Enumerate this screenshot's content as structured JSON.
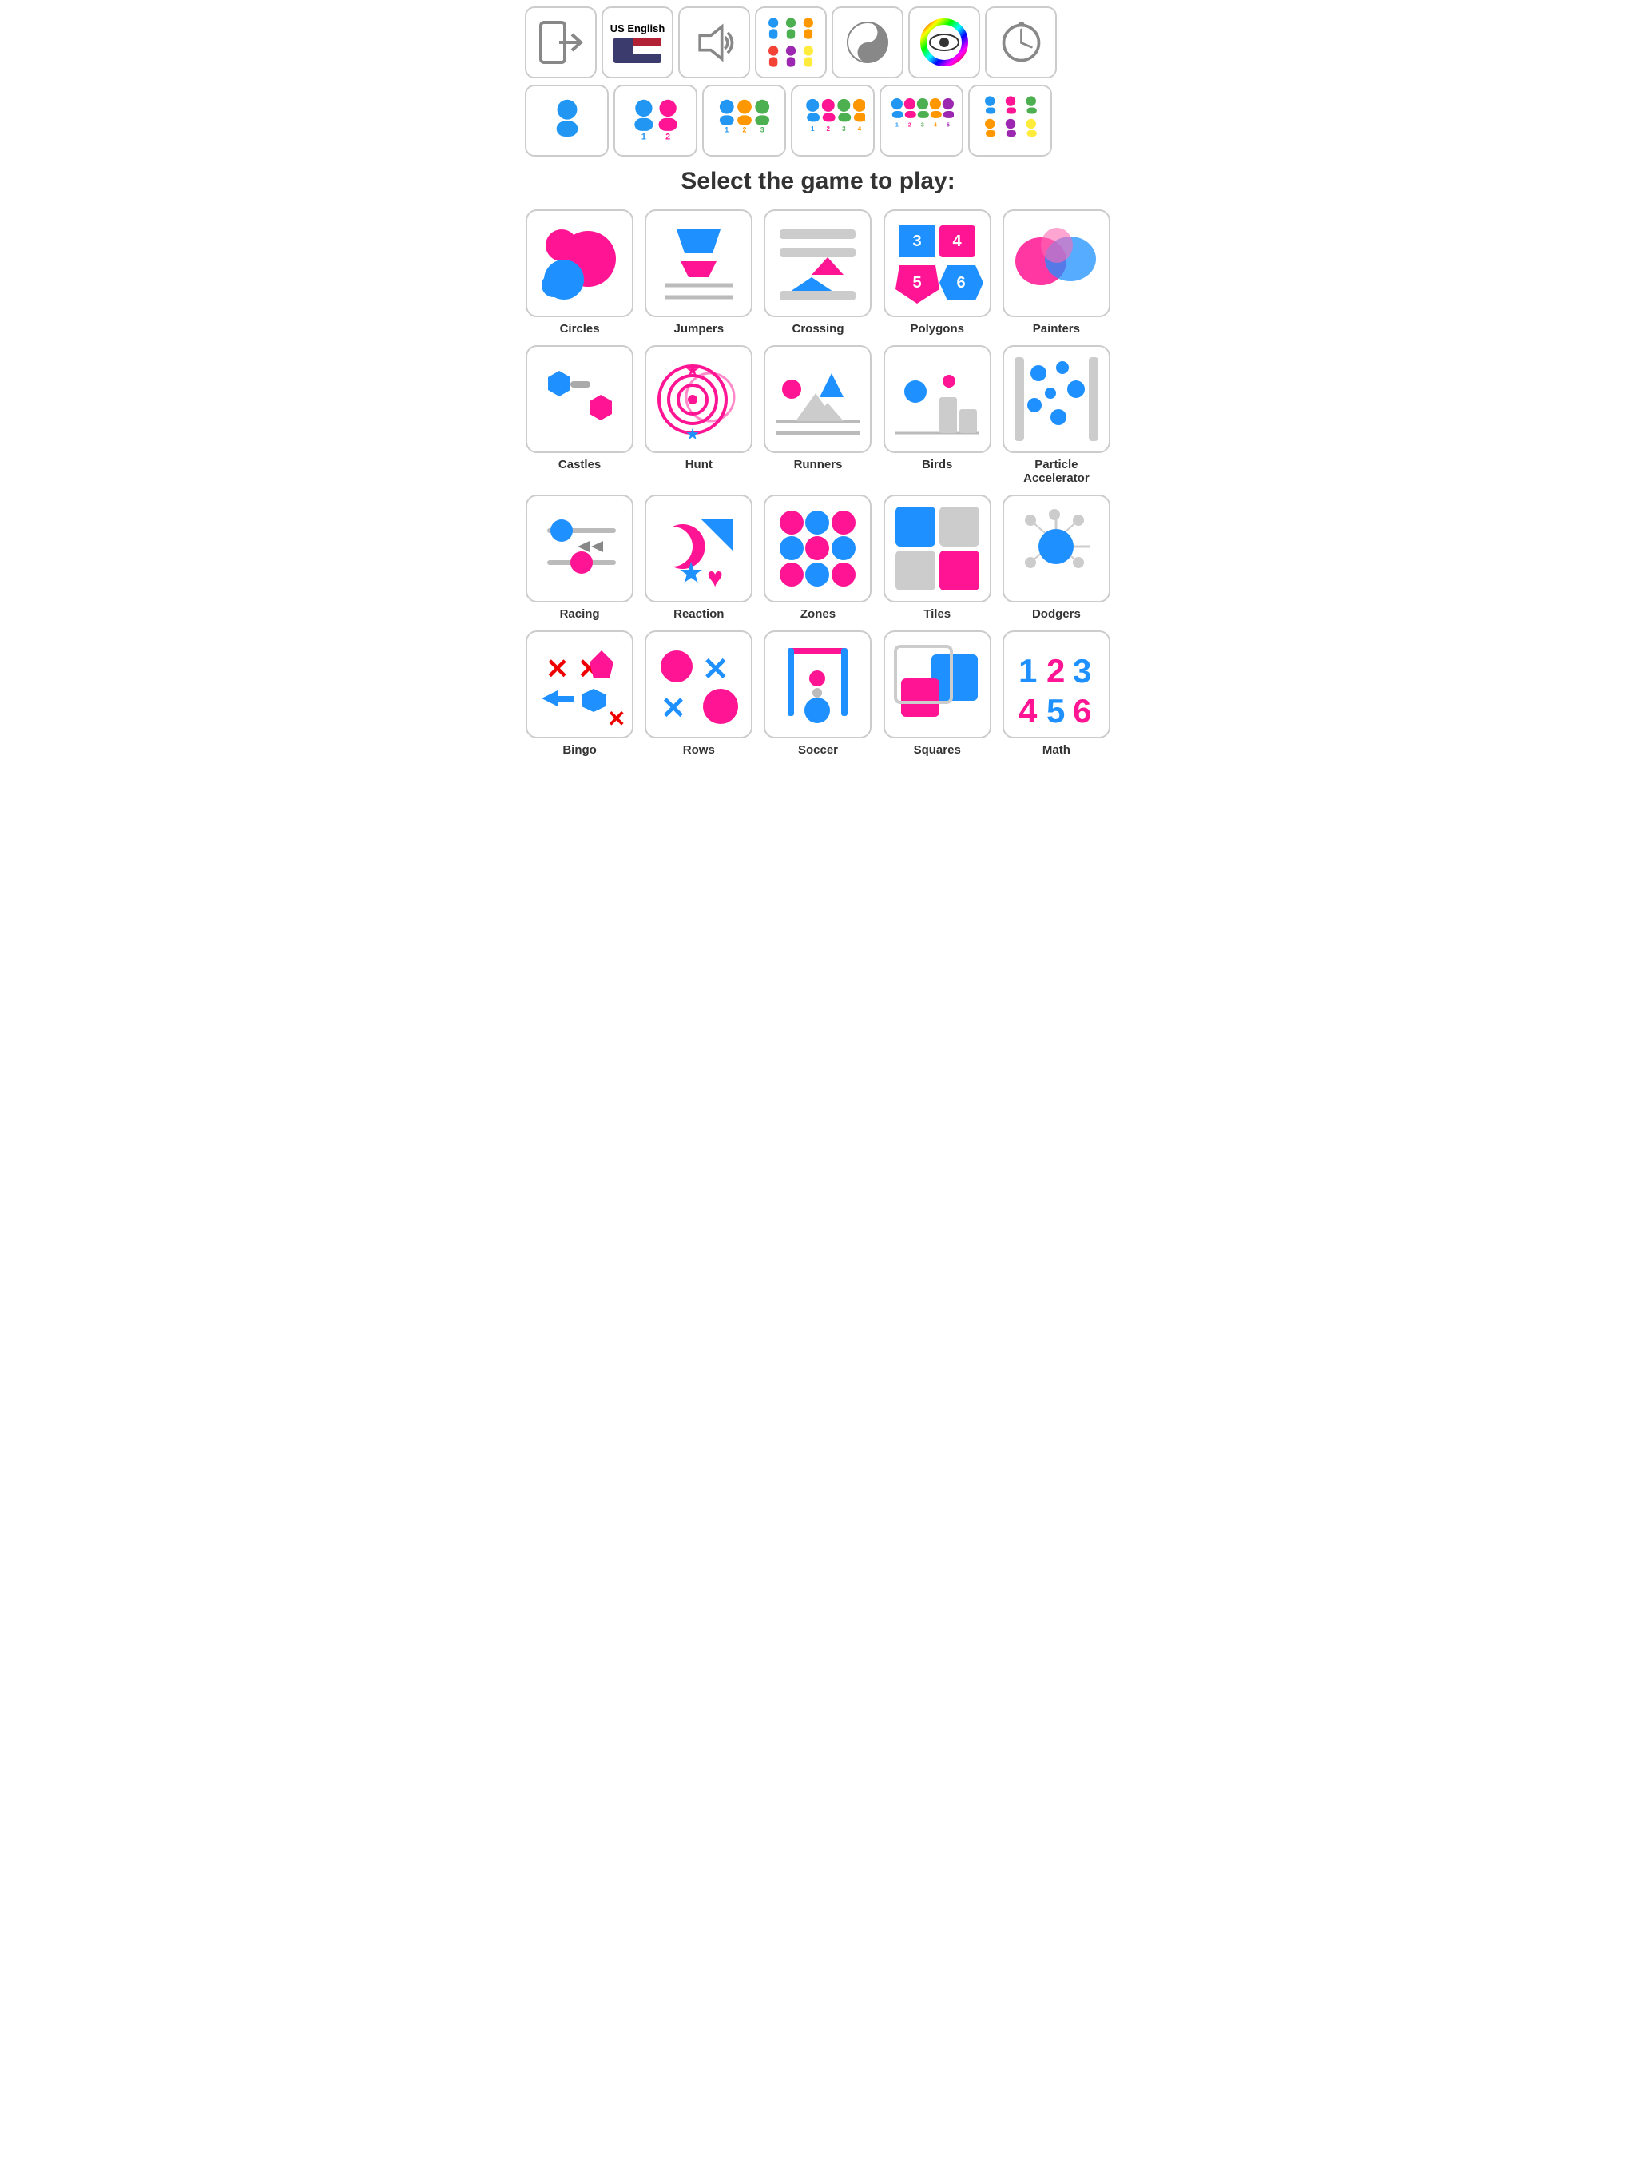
{
  "toolbar": {
    "lang_label": "US English",
    "items": [
      {
        "name": "exit-button",
        "label": "Exit"
      },
      {
        "name": "language-button",
        "label": "US English"
      },
      {
        "name": "sound-button",
        "label": "Sound"
      },
      {
        "name": "players-button",
        "label": "Players"
      },
      {
        "name": "yin-yang-button",
        "label": "Yin Yang"
      },
      {
        "name": "eye-button",
        "label": "Eye"
      },
      {
        "name": "clock-button",
        "label": "Clock"
      }
    ]
  },
  "players": [
    {
      "name": "1-player",
      "label": "1 player"
    },
    {
      "name": "2-players",
      "label": "2 players"
    },
    {
      "name": "3-players",
      "label": "3 players"
    },
    {
      "name": "4-players",
      "label": "4 players"
    },
    {
      "name": "5-players",
      "label": "5 players"
    },
    {
      "name": "6-players",
      "label": "6 players"
    }
  ],
  "select_title": "Select the game to play:",
  "games": [
    {
      "id": "circles",
      "label": "Circles"
    },
    {
      "id": "jumpers",
      "label": "Jumpers"
    },
    {
      "id": "crossing",
      "label": "Crossing"
    },
    {
      "id": "polygons",
      "label": "Polygons"
    },
    {
      "id": "painters",
      "label": "Painters"
    },
    {
      "id": "castles",
      "label": "Castles"
    },
    {
      "id": "hunt",
      "label": "Hunt"
    },
    {
      "id": "runners",
      "label": "Runners"
    },
    {
      "id": "birds",
      "label": "Birds"
    },
    {
      "id": "particle-accelerator",
      "label": "Particle Accelerator"
    },
    {
      "id": "racing",
      "label": "Racing"
    },
    {
      "id": "reaction",
      "label": "Reaction"
    },
    {
      "id": "zones",
      "label": "Zones"
    },
    {
      "id": "tiles",
      "label": "Tiles"
    },
    {
      "id": "dodgers",
      "label": "Dodgers"
    },
    {
      "id": "bingo",
      "label": "Bingo"
    },
    {
      "id": "rows",
      "label": "Rows"
    },
    {
      "id": "soccer",
      "label": "Soccer"
    },
    {
      "id": "squares",
      "label": "Squares"
    },
    {
      "id": "math",
      "label": "Math"
    }
  ],
  "colors": {
    "pink": "#FF1493",
    "blue": "#1E90FF",
    "gray": "#aaa",
    "red": "#e00"
  }
}
